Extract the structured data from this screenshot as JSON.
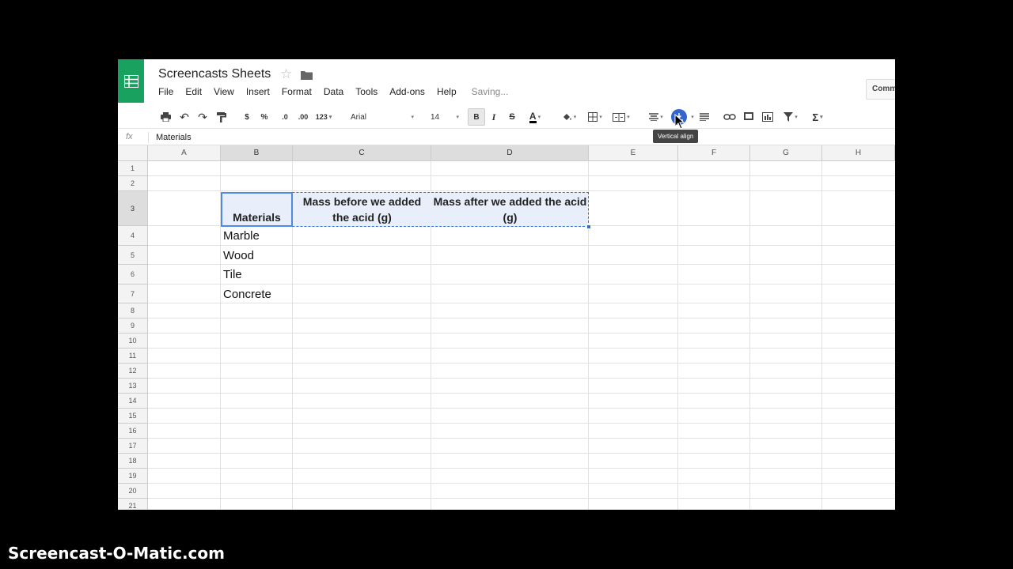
{
  "document": {
    "title": "Screencasts Sheets",
    "status": "Saving..."
  },
  "menu": [
    "File",
    "Edit",
    "View",
    "Insert",
    "Format",
    "Data",
    "Tools",
    "Add-ons",
    "Help"
  ],
  "comments_label": "Comm",
  "toolbar": {
    "currency": "$",
    "percent": "%",
    "decrease_decimals": ".0",
    "increase_decimals": ".00",
    "more_formats": "123",
    "font": "Arial",
    "font_size": "14",
    "bold": "B",
    "italic": "I",
    "strikethrough": "S",
    "text_color": "A",
    "functions": "Σ",
    "tooltip": "Vertical align"
  },
  "formula_bar": {
    "fx_label": "fx",
    "value": "Materials"
  },
  "columns": [
    "A",
    "B",
    "C",
    "D",
    "E",
    "F",
    "G",
    "H"
  ],
  "rows": [
    "1",
    "2",
    "3",
    "4",
    "5",
    "6",
    "7",
    "8",
    "9",
    "10",
    "11",
    "12",
    "13",
    "14",
    "15",
    "16",
    "17",
    "18",
    "19",
    "20",
    "21"
  ],
  "cells": {
    "B3": "Materials",
    "C3": "Mass before we added the acid (g)",
    "D3": "Mass after we added the acid (g)",
    "B4": "Marble",
    "B5": "Wood",
    "B6": "Tile",
    "B7": "Concrete"
  },
  "selection": {
    "active_cell": "B3",
    "range": "B3:D3"
  },
  "watermark": "Screencast-O-Matic.com",
  "colors": {
    "brand": "#18a15f",
    "selection": "#2f6fd0",
    "selection_fill": "#e8effb"
  }
}
